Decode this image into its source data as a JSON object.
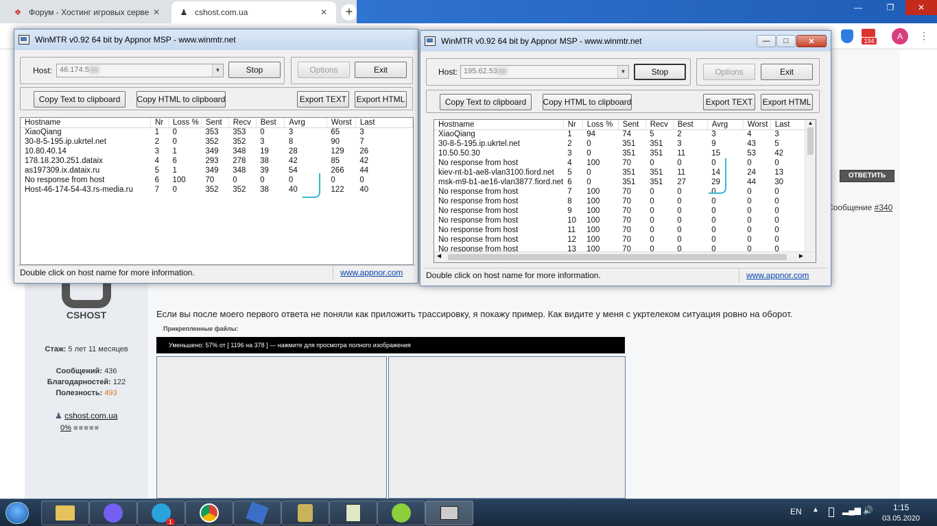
{
  "browser": {
    "tabs": [
      {
        "title": "Форум - Хостинг игровых серве",
        "icon": "forum-favicon-icon"
      },
      {
        "title": "cshost.com.ua",
        "icon": "cshost-favicon-icon"
      }
    ],
    "new_tab": "+",
    "notif_count": "194",
    "avatar": "A"
  },
  "forum": {
    "brand": "CSHOST",
    "stazh_label": "Стаж:",
    "stazh_value": "5 лет 11 месяцев",
    "posts_label": "Сообщений:",
    "posts_value": "436",
    "thanks_label": "Благодарностей:",
    "thanks_value": "122",
    "rep_label": "Полезность:",
    "rep_value": "493",
    "site": "cshost.com.ua",
    "percent": "0%",
    "reply_button": "ОТВЕТИТЬ",
    "msg_label": "Сообщение",
    "msg_num": "#340",
    "post_text": "Если вы после моего первого ответа не поняли как приложить трассировку, я покажу пример. Как видите у меня с укртелеком ситуация ровно на оборот.",
    "attachments": "Прикрепленные файлы:",
    "image_bar": "Уменьшено: 57% от [ 1196 на 378 ] — нажмите для просмотра полного изображения"
  },
  "winmtr1": {
    "title": "WinMTR v0.92 64 bit by Appnor MSP - www.winmtr.net",
    "host_label": "Host:",
    "host_value": "46.174.5",
    "stop": "Stop",
    "options": "Options",
    "exit": "Exit",
    "copy_text": "Copy Text to clipboard",
    "copy_html": "Copy HTML to clipboard",
    "export_text": "Export TEXT",
    "export_html": "Export HTML",
    "headers": [
      "Hostname",
      "Nr",
      "Loss %",
      "Sent",
      "Recv",
      "Best",
      "Avrg",
      "Worst",
      "Last"
    ],
    "rows": [
      [
        "XiaoQiang",
        "1",
        "0",
        "353",
        "353",
        "0",
        "3",
        "65",
        "3"
      ],
      [
        "30-8-5-195.ip.ukrtel.net",
        "2",
        "0",
        "352",
        "352",
        "3",
        "8",
        "90",
        "7"
      ],
      [
        "10.80.40.14",
        "3",
        "1",
        "349",
        "348",
        "19",
        "28",
        "129",
        "26"
      ],
      [
        "178.18.230.251.dataix",
        "4",
        "6",
        "293",
        "278",
        "38",
        "42",
        "85",
        "42"
      ],
      [
        "as197309.ix.dataix.ru",
        "5",
        "1",
        "349",
        "348",
        "39",
        "54",
        "266",
        "44"
      ],
      [
        "No response from host",
        "6",
        "100",
        "70",
        "0",
        "0",
        "0",
        "0",
        "0"
      ],
      [
        "Host-46-174-54-43.rs-media.ru",
        "7",
        "0",
        "352",
        "352",
        "38",
        "40",
        "122",
        "40"
      ]
    ],
    "status": "Double click on host name for more information.",
    "link": "www.appnor.com"
  },
  "winmtr2": {
    "title": "WinMTR v0.92 64 bit by Appnor MSP - www.winmtr.net",
    "host_label": "Host:",
    "host_value": "195.62.53",
    "stop": "Stop",
    "options": "Options",
    "exit": "Exit",
    "copy_text": "Copy Text to clipboard",
    "copy_html": "Copy HTML to clipboard",
    "export_text": "Export TEXT",
    "export_html": "Export HTML",
    "headers": [
      "Hostname",
      "Nr",
      "Loss %",
      "Sent",
      "Recv",
      "Best",
      "Avrg",
      "Worst",
      "Last"
    ],
    "rows": [
      [
        "XiaoQiang",
        "1",
        "94",
        "74",
        "5",
        "2",
        "3",
        "4",
        "3"
      ],
      [
        "30-8-5-195.ip.ukrtel.net",
        "2",
        "0",
        "351",
        "351",
        "3",
        "9",
        "43",
        "5"
      ],
      [
        "10.50.50.30",
        "3",
        "0",
        "351",
        "351",
        "11",
        "15",
        "53",
        "42"
      ],
      [
        "No response from host",
        "4",
        "100",
        "70",
        "0",
        "0",
        "0",
        "0",
        "0"
      ],
      [
        "kiev-nt-b1-ae8-vlan3100.fiord.net",
        "5",
        "0",
        "351",
        "351",
        "11",
        "14",
        "24",
        "13"
      ],
      [
        "msk-m9-b1-ae16-vlan3877.fiord.net",
        "6",
        "0",
        "351",
        "351",
        "27",
        "29",
        "44",
        "30"
      ],
      [
        "No response from host",
        "7",
        "100",
        "70",
        "0",
        "0",
        "0",
        "0",
        "0"
      ],
      [
        "No response from host",
        "8",
        "100",
        "70",
        "0",
        "0",
        "0",
        "0",
        "0"
      ],
      [
        "No response from host",
        "9",
        "100",
        "70",
        "0",
        "0",
        "0",
        "0",
        "0"
      ],
      [
        "No response from host",
        "10",
        "100",
        "70",
        "0",
        "0",
        "0",
        "0",
        "0"
      ],
      [
        "No response from host",
        "11",
        "100",
        "70",
        "0",
        "0",
        "0",
        "0",
        "0"
      ],
      [
        "No response from host",
        "12",
        "100",
        "70",
        "0",
        "0",
        "0",
        "0",
        "0"
      ],
      [
        "No response from host",
        "13",
        "100",
        "70",
        "0",
        "0",
        "0",
        "0",
        "0"
      ]
    ],
    "status": "Double click on host name for more information.",
    "link": "www.appnor.com"
  },
  "taskbar": {
    "lang": "EN",
    "time": "1:15",
    "date": "03.05.2020",
    "telegram_badge": "1"
  }
}
